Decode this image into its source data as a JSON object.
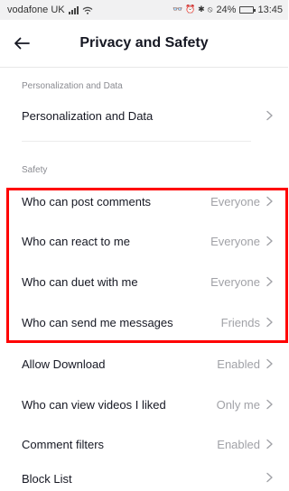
{
  "status_bar": {
    "carrier": "vodafone UK",
    "wifi_icon": "wifi-icon",
    "status_icons": "👓 ⏰ ✱ ⦸",
    "battery": "24%",
    "time": "13:45"
  },
  "nav": {
    "title": "Privacy and Safety",
    "back_icon": "arrow-left-icon"
  },
  "sections": {
    "personalization": {
      "header": "Personalization and Data",
      "row_label": "Personalization and Data"
    },
    "safety": {
      "header": "Safety"
    }
  },
  "rows": [
    {
      "label": "Who can post comments",
      "value": "Everyone"
    },
    {
      "label": "Who can react to me",
      "value": "Everyone"
    },
    {
      "label": "Who can duet with me",
      "value": "Everyone"
    },
    {
      "label": "Who can send me messages",
      "value": "Friends"
    },
    {
      "label": "Allow Download",
      "value": "Enabled"
    },
    {
      "label": "Who can view videos I liked",
      "value": "Only me"
    },
    {
      "label": "Comment filters",
      "value": "Enabled"
    },
    {
      "label": "Block List",
      "value": ""
    }
  ],
  "colors": {
    "highlight": "#ff0000",
    "value_text": "#a1a2a7",
    "section_header": "#8a8b91"
  }
}
